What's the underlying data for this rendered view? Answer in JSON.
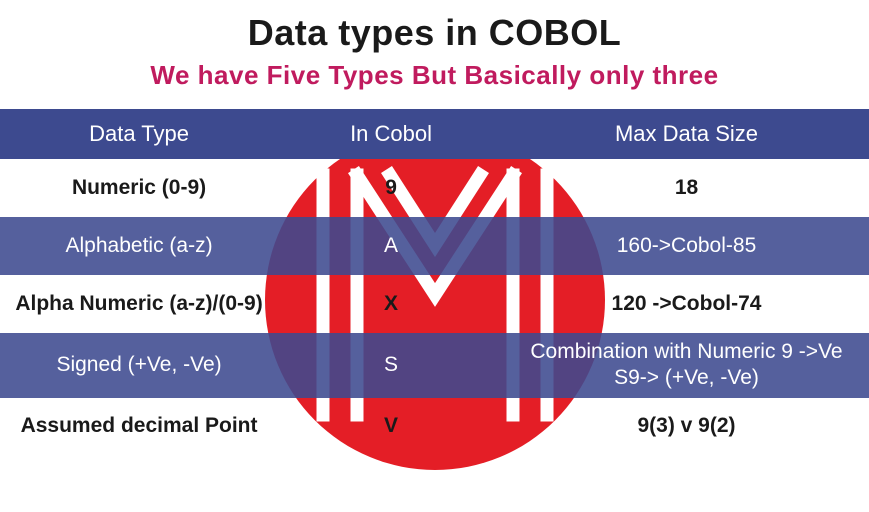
{
  "title": "Data types in COBOL",
  "subtitle": "We have Five Types But Basically only three",
  "header": {
    "c1": "Data Type",
    "c2": "In Cobol",
    "c3": "Max Data Size"
  },
  "rows": [
    {
      "style": "plain",
      "c1": "Numeric (0-9)",
      "c2": "9",
      "c3": "18"
    },
    {
      "style": "blue",
      "c1": "Alphabetic (a-z)",
      "c2": "A",
      "c3": "160->Cobol-85"
    },
    {
      "style": "plain",
      "c1": "Alpha Numeric (a-z)/(0-9)",
      "c2": "X",
      "c3": "120 ->Cobol-74"
    },
    {
      "style": "blue",
      "c1": "Signed (+Ve, -Ve)",
      "c2": "S",
      "c3": "Combination with Numeric 9 ->Ve S9-> (+Ve, -Ve)"
    },
    {
      "style": "plain",
      "c1": "Assumed decimal Point",
      "c2": "V",
      "c3": "9(3) v 9(2)"
    }
  ]
}
